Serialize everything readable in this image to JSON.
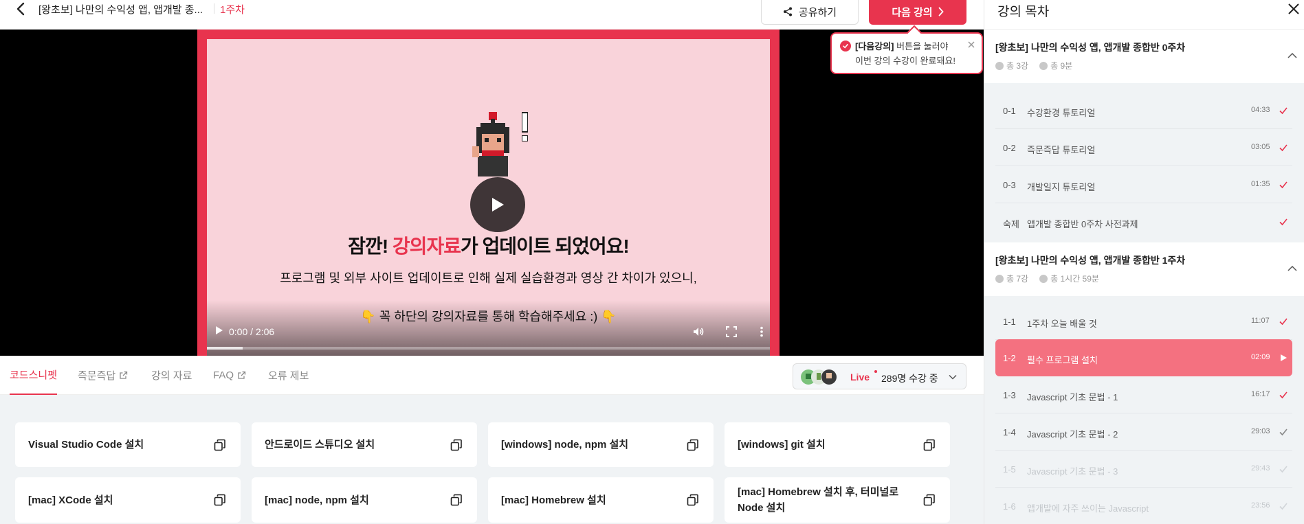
{
  "header": {
    "course_title": "[왕초보] 나만의 수익성 앱, 앱개발 종...",
    "week_label": "1주차",
    "share_label": "공유하기",
    "next_label": "다음 강의"
  },
  "tooltip": {
    "bracket": "[다음강의]",
    "line1_rest": " 버튼을 눌러야",
    "line2": "이번 강의 수강이 완료돼요!"
  },
  "video": {
    "headline_before": "잠깐! ",
    "headline_highlight": "강의자료",
    "headline_after": "가 업데이트 되었어요!",
    "subtitle1": "프로그램 및 외부 사이트 업데이트로 인해 실제 실습환경과 영상 간 차이가 있으니,",
    "subtitle2": "👇 꼭 하단의 강의자료를 통해 학습해주세요 :) 👇",
    "time": "0:00 / 2:06",
    "buffered_fraction": 0.063
  },
  "tabs": [
    {
      "label": "코드스니펫"
    },
    {
      "label": "즉문즉답"
    },
    {
      "label": "강의 자료"
    },
    {
      "label": "FAQ"
    },
    {
      "label": "오류 제보"
    }
  ],
  "live": {
    "label": "Live",
    "count": "289명 수강 중"
  },
  "snippets": [
    {
      "label": "Visual Studio Code 설치"
    },
    {
      "label": "안드로이드 스튜디오 설치"
    },
    {
      "label": "[windows] node, npm 설치"
    },
    {
      "label": "[windows] git 설치"
    },
    {
      "label": "[mac] XCode 설치"
    },
    {
      "label": "[mac] node, npm 설치"
    },
    {
      "label": "[mac] Homebrew 설치"
    },
    {
      "label": "[mac] Homebrew 설치 후, 터미널로 Node 설치"
    }
  ],
  "toc": {
    "title": "강의 목차",
    "sections": [
      {
        "title": "[왕초보] 나만의 수익성 앱, 앱개발 종합반 0주차",
        "count": "총 3강",
        "duration": "총 9분",
        "items": [
          {
            "num": "0-1",
            "title": "수강환경 튜토리얼",
            "dur": "04:33"
          },
          {
            "num": "0-2",
            "title": "즉문즉답 튜토리얼",
            "dur": "03:05"
          },
          {
            "num": "0-3",
            "title": "개발일지 튜토리얼",
            "dur": "01:35"
          },
          {
            "num": "숙제",
            "title": "앱개발 종합반 0주차 사전과제",
            "dur": ""
          }
        ]
      },
      {
        "title": "[왕초보] 나만의 수익성 앱, 앱개발 종합반 1주차",
        "count": "총 7강",
        "duration": "총 1시간 59분",
        "items": [
          {
            "num": "1-1",
            "title": "1주차 오늘 배울 것",
            "dur": "11:07"
          },
          {
            "num": "1-2",
            "title": "필수 프로그램 설치",
            "dur": "02:09"
          },
          {
            "num": "1-3",
            "title": "Javascript 기초 문법 - 1",
            "dur": "16:17"
          },
          {
            "num": "1-4",
            "title": "Javascript 기초 문법 - 2",
            "dur": "29:03"
          },
          {
            "num": "1-5",
            "title": "Javascript 기초 문법 - 3",
            "dur": "29:43"
          },
          {
            "num": "1-6",
            "title": "앱개발에 자주 쓰이는 Javascript",
            "dur": "23:56"
          }
        ]
      }
    ]
  },
  "colors": {
    "accent": "#e8344e",
    "active_item": "#f47180",
    "slide_bg": "#f9d3da"
  }
}
